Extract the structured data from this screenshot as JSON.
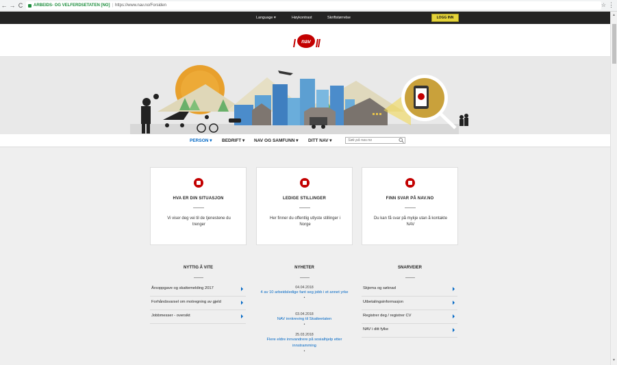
{
  "browser": {
    "back": "←",
    "forward": "→",
    "reload": "C",
    "secure_label": "ARBEIDS- OG VELFERDSETATEN [NO]",
    "separator": "|",
    "url": "https://www.nav.no/Forsiden",
    "star": "☆",
    "menu": "⋮"
  },
  "topbar": {
    "language": "Language ▾",
    "contrast": "Høykontrast",
    "font_size": "Skriftstørrelse",
    "login": "LOGG INN"
  },
  "brand": {
    "color": "#c30000",
    "accent_blue": "#0067c5",
    "login_yellow": "#e5d43a",
    "logo_text": "nav"
  },
  "mainnav": {
    "items": [
      "PERSON ▾",
      "BEDRIFT ▾",
      "NAV OG SAMFUNN ▾",
      "DITT NAV ▾"
    ],
    "search_placeholder": "Søk på nav.no"
  },
  "cards": [
    {
      "title": "HVA ER DIN SITUASJON",
      "desc": "Vi viser deg vei til de tjenestene du trenger"
    },
    {
      "title": "LEDIGE STILLINGER",
      "desc": "Her finner du offentlig utlyste stillinger i Norge"
    },
    {
      "title": "FINN SVAR PÅ NAV.NO",
      "desc": "Du kan få svar på mykje utan å kontakte NAV"
    }
  ],
  "nyttig": {
    "title": "NYTTIG Å VITE",
    "items": [
      "Årsoppgave og skattemelding 2017",
      "Forhåndsvarsel om motregning av gjeld",
      "Jobbmesser - oversikt"
    ]
  },
  "nyheter": {
    "title": "NYHETER",
    "items": [
      {
        "date": "04.04.2018",
        "text": "4 av 10 arbeidsledige fant seg jobb i et annet yrke"
      },
      {
        "date": "03.04.2018",
        "text": "NAV innkreving til Skatteetaten"
      },
      {
        "date": "25.03.2018",
        "text": "Flere eldre innvandrere på sosialhjelp etter innstramming"
      }
    ],
    "bullet": "•"
  },
  "snarveier": {
    "title": "SNARVEIER",
    "items": [
      "Skjema og søknad",
      "Utbetalingsinformasjon",
      "Registrer deg / registrer CV",
      "NAV i ditt fylke"
    ]
  }
}
